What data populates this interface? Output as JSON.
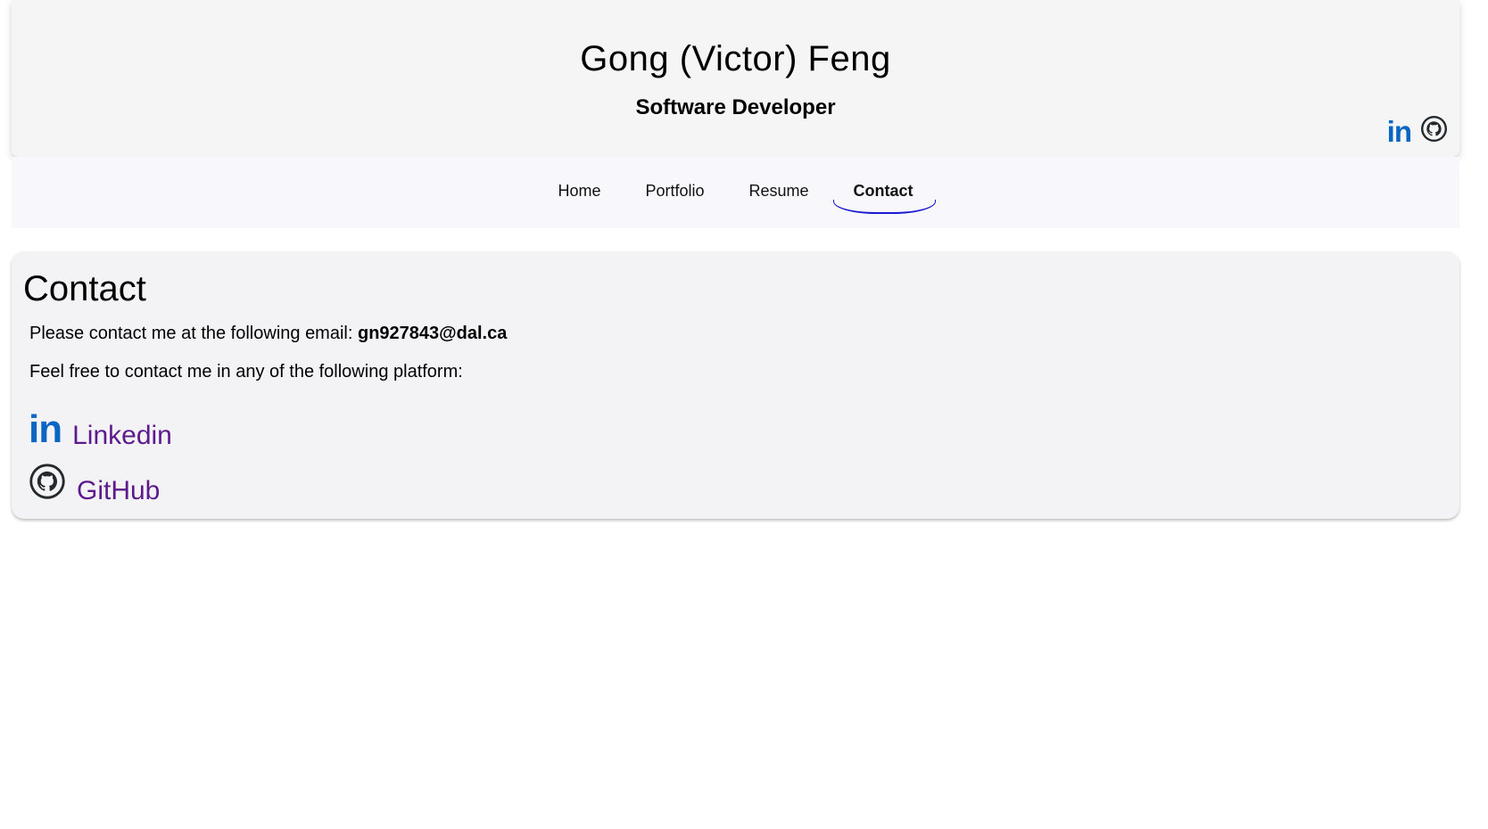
{
  "header": {
    "name": "Gong (Victor) Feng",
    "title": "Software Developer",
    "social_icons": [
      "linkedin-icon",
      "github-icon"
    ]
  },
  "nav": {
    "items": [
      {
        "label": "Home"
      },
      {
        "label": "Portfolio"
      },
      {
        "label": "Resume"
      },
      {
        "label": "Contact",
        "active": true
      }
    ]
  },
  "contact": {
    "heading": "Contact",
    "email_prefix": "Please contact me at the following email:",
    "email": "gn927843@dal.ca",
    "platform_text": "Feel free to contact me in any of the following platform:",
    "links": [
      {
        "label": "Linkedin",
        "icon": "linkedin-icon"
      },
      {
        "label": "GitHub",
        "icon": "github-icon"
      }
    ]
  },
  "colors": {
    "accent": "#1a1ad0",
    "link": "#5c1a8c",
    "linkedin": "#0a66c2"
  }
}
